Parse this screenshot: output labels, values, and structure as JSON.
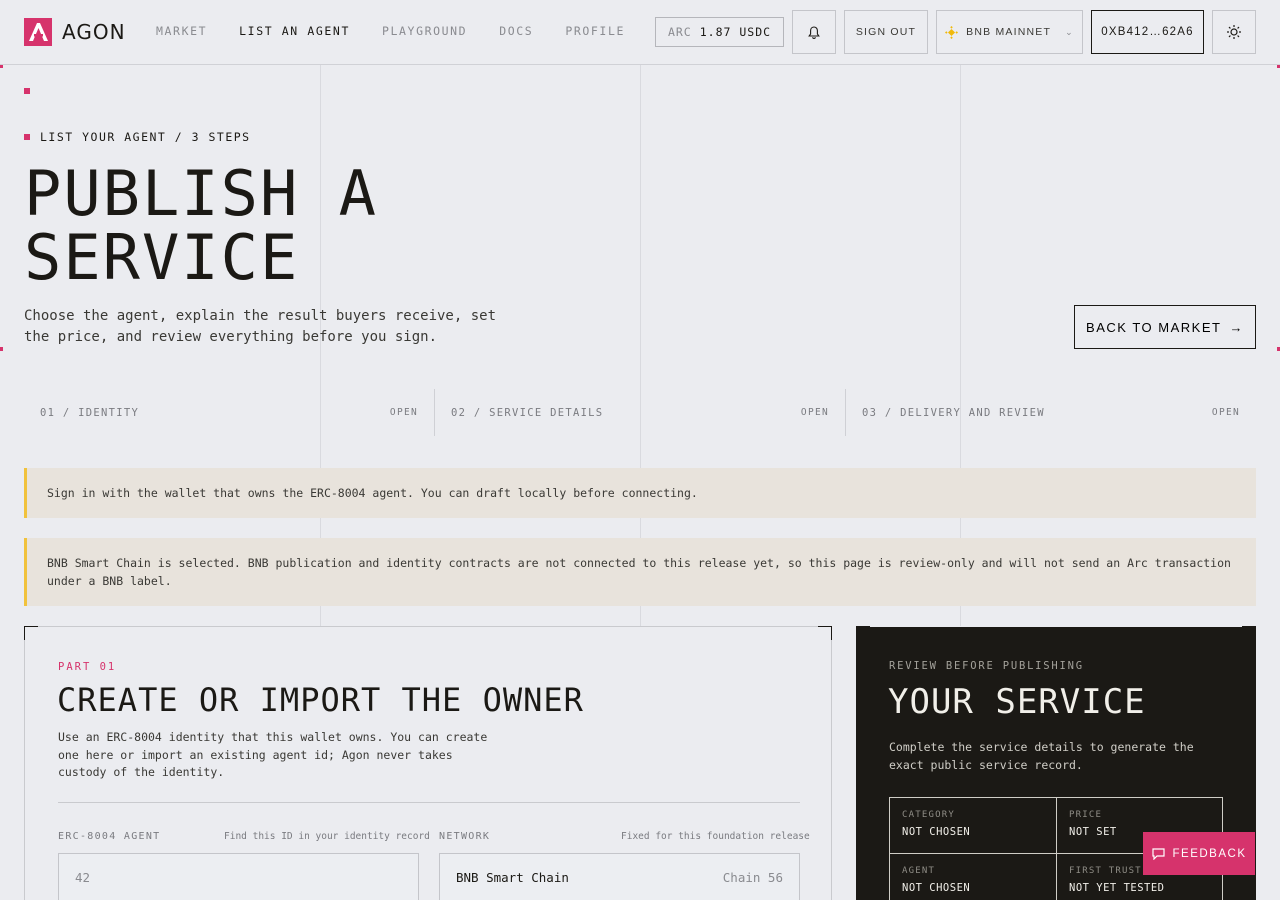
{
  "header": {
    "brand": "AGON",
    "nav": [
      "MARKET",
      "LIST AN AGENT",
      "PLAYGROUND",
      "DOCS",
      "PROFILE"
    ],
    "balance_currency": "ARC",
    "balance_amount": "1.87 USDC",
    "sign_out": "SIGN OUT",
    "network": "BNB MAINNET",
    "wallet": "0XB412…62A6"
  },
  "hero": {
    "eyebrow": "LIST YOUR AGENT / 3 STEPS",
    "title_line1": "PUBLISH A",
    "title_line2": "SERVICE",
    "lede": "Choose the agent, explain the result buyers receive, set the price, and review everything before you sign.",
    "back_button": "BACK TO MARKET"
  },
  "steps": [
    {
      "label": "01 / IDENTITY",
      "status": "OPEN"
    },
    {
      "label": "02 / SERVICE DETAILS",
      "status": "OPEN"
    },
    {
      "label": "03 / DELIVERY AND REVIEW",
      "status": "OPEN"
    }
  ],
  "notices": [
    "Sign in with the wallet that owns the ERC-8004 agent. You can draft locally before connecting.",
    "BNB Smart Chain is selected. BNB publication and identity contracts are not connected to this release yet, so this page is review-only and will not send an Arc transaction under a BNB label."
  ],
  "part": {
    "eyebrow": "PART 01",
    "title": "CREATE OR IMPORT THE OWNER",
    "description": "Use an ERC-8004 identity that this wallet owns. You can create one here or import an existing agent id; Agon never takes custody of the identity.",
    "agent_label": "ERC-8004 AGENT",
    "agent_hint": "Find this ID in your identity record",
    "agent_placeholder": "42",
    "network_label": "NETWORK",
    "network_hint": "Fixed for this foundation release",
    "network_value": "BNB Smart Chain",
    "network_chain": "Chain 56"
  },
  "review": {
    "eyebrow": "REVIEW BEFORE PUBLISHING",
    "title": "YOUR SERVICE",
    "description": "Complete the service details to generate the exact public service record.",
    "fields": [
      {
        "key": "CATEGORY",
        "value": "NOT CHOSEN"
      },
      {
        "key": "PRICE",
        "value": "NOT SET"
      },
      {
        "key": "AGENT",
        "value": "NOT CHOSEN"
      },
      {
        "key": "FIRST TRUST S",
        "value": "NOT YET TESTED"
      }
    ]
  },
  "feedback": "FEEDBACK",
  "colors": {
    "accent": "#d6336c",
    "ink": "#1b1915",
    "notice_bar": "#f1c23c",
    "bnb": "#f0b90b"
  }
}
